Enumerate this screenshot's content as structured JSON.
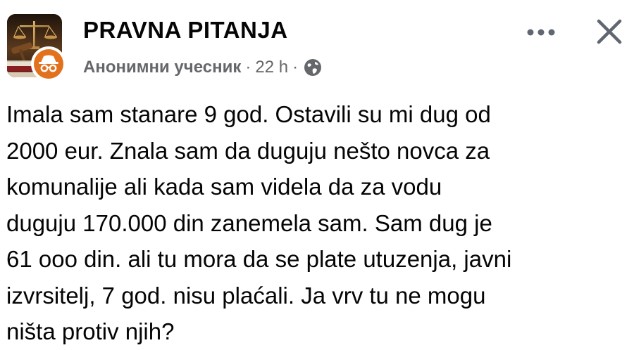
{
  "group": {
    "name": "PRAVNA PITANJA"
  },
  "post_meta": {
    "author": "Анонимни учесник",
    "separator": "·",
    "time": "22 h",
    "separator2": "·",
    "privacy_icon": "globe-icon"
  },
  "actions": {
    "more_icon": "more-options-icon",
    "close_icon": "close-icon"
  },
  "post": {
    "lines": [
      "Imala sam stanare 9 god. Ostavili su mi dug od",
      "2000 eur. Znala sam da duguju nešto novca za",
      "komunalije ali kada sam videla da za vodu",
      "duguju 170.000 din zanemela sam. Sam dug je",
      "61 ooo din. ali tu mora da se plate utuzenja, javni",
      "izvrsitelj, 7 god. nisu plaćali. Ja vrv tu ne mogu",
      "ništa protiv njih?"
    ]
  },
  "colors": {
    "text_primary": "#050505",
    "text_secondary": "#65676b",
    "anon_badge": "#e2711d",
    "icon": "#606770"
  }
}
